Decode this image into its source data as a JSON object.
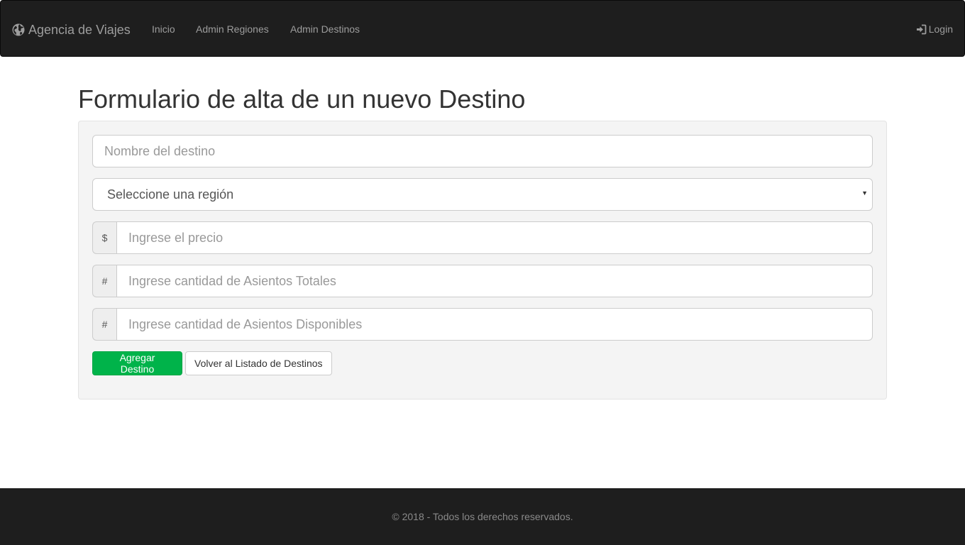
{
  "navbar": {
    "brand": "Agencia de Viajes",
    "brand_icon": "globe-icon",
    "links": [
      "Inicio",
      "Admin Regiones",
      "Admin Destinos"
    ],
    "login_label": "Login",
    "login_icon": "login-icon"
  },
  "page_title": "Formulario de alta de un nuevo Destino",
  "form": {
    "nombre_placeholder": "Nombre del destino",
    "region_selected": "Seleccione una región",
    "precio_addon": "$",
    "precio_placeholder": "Ingrese el precio",
    "asientos_totales_addon": "#",
    "asientos_totales_placeholder": "Ingrese cantidad de Asientos Totales",
    "asientos_disponibles_addon": "#",
    "asientos_disponibles_placeholder": "Ingrese cantidad de Asientos Disponibles",
    "submit_label": "Agregar Destino",
    "back_label": "Volver al Listado de Destinos"
  },
  "footer": {
    "text": "© 2018 - Todos los derechos reservados."
  },
  "colors": {
    "navbar_bg": "#1e1e1e",
    "success": "#00b34a",
    "well_bg": "#f4f4f4"
  }
}
